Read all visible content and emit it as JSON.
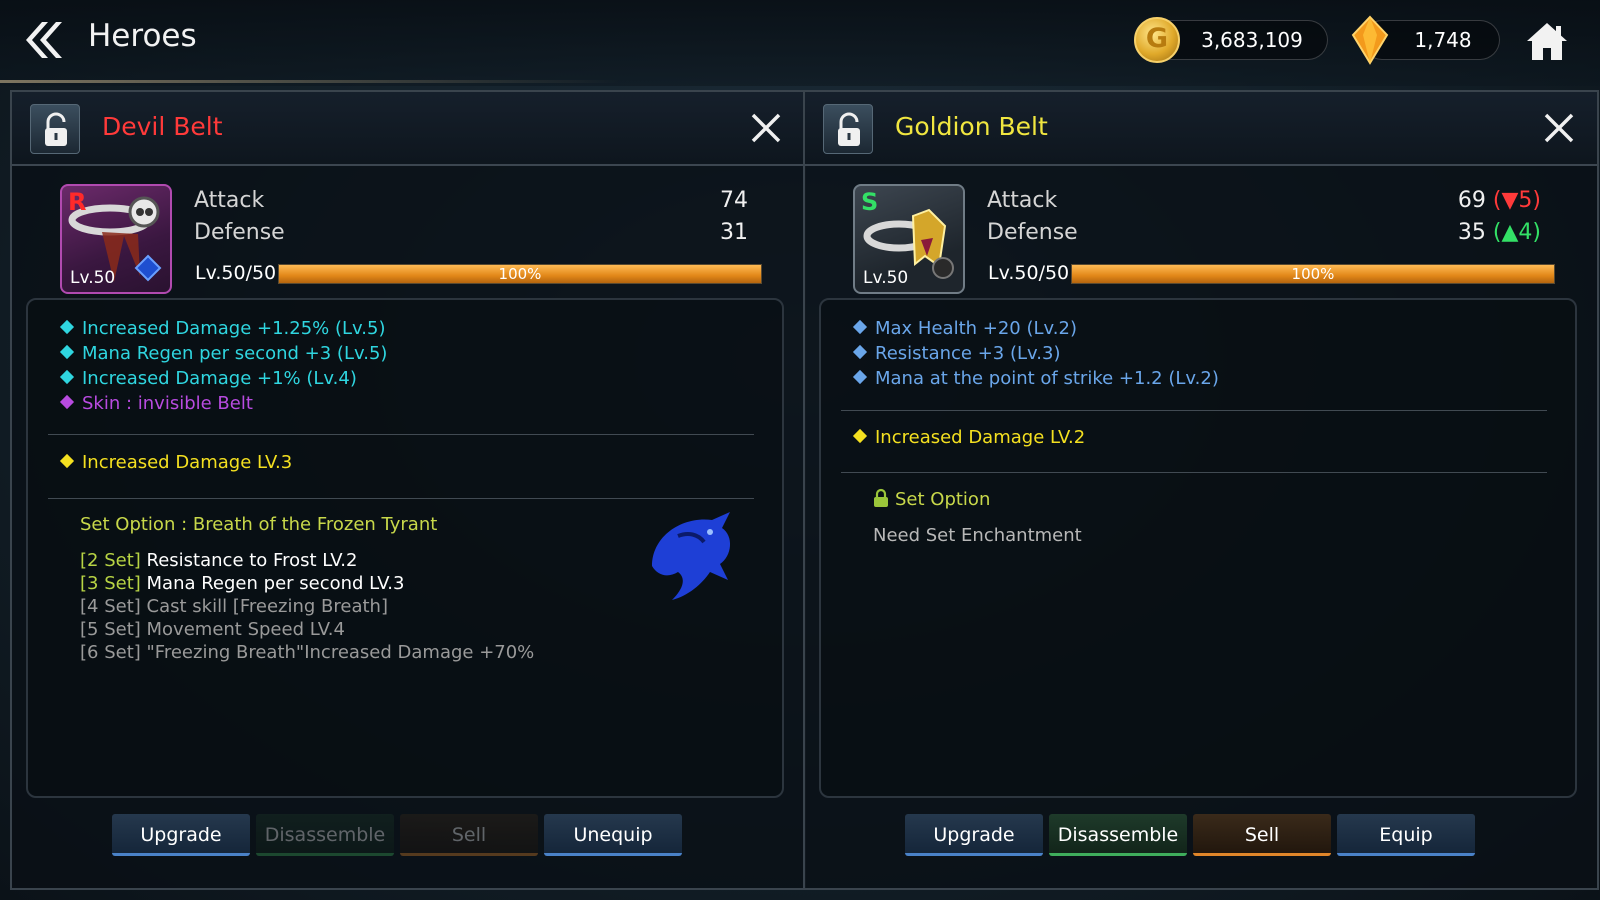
{
  "header": {
    "title": "Heroes",
    "gold": "3,683,109",
    "gold_icon_letter": "G",
    "gems": "1,748"
  },
  "left": {
    "name": "Devil Belt",
    "name_color": "#ff3a3a",
    "grade": "R",
    "icon_level": "Lv.50",
    "attack_label": "Attack",
    "attack_value": "74",
    "defense_label": "Defense",
    "defense_value": "31",
    "level_label": "Lv.50/50",
    "progress_text": "100%",
    "progress_fraction": 1.0,
    "options": [
      {
        "text": "Increased Damage +1.25% (Lv.5)",
        "color": "#2fd6e0"
      },
      {
        "text": "Mana Regen per second +3 (Lv.5)",
        "color": "#2fd6e0"
      },
      {
        "text": "Increased Damage +1% (Lv.4)",
        "color": "#2fd6e0"
      },
      {
        "text": "Skin : invisible Belt",
        "color": "#b84be0"
      }
    ],
    "special": "Increased Damage LV.3",
    "set_title": "Set Option : Breath of the Frozen Tyrant",
    "set_items": [
      {
        "tag": "[2 Set]",
        "text": "Resistance to Frost LV.2",
        "active": true
      },
      {
        "tag": "[3 Set]",
        "text": "Mana Regen per second LV.3",
        "active": true
      },
      {
        "tag": "[4 Set]",
        "text": "Cast skill [Freezing Breath]",
        "active": false
      },
      {
        "tag": "[5 Set]",
        "text": "Movement Speed LV.4",
        "active": false
      },
      {
        "tag": "[6 Set]",
        "text": "\"Freezing Breath\"Increased Damage +70%",
        "active": false
      }
    ],
    "buttons": {
      "upgrade": "Upgrade",
      "disassemble": "Disassemble",
      "sell": "Sell",
      "unequip": "Unequip"
    }
  },
  "right": {
    "name": "Goldion Belt",
    "name_color": "#f0e640",
    "grade": "S",
    "icon_level": "Lv.50",
    "attack_label": "Attack",
    "attack_value": "69",
    "attack_diff": "(▼5)",
    "defense_label": "Defense",
    "defense_value": "35",
    "defense_diff": "(▲4)",
    "level_label": "Lv.50/50",
    "progress_text": "100%",
    "progress_fraction": 1.0,
    "options": [
      {
        "text": "Max Health +20 (Lv.2)",
        "color": "#6aa6ea"
      },
      {
        "text": "Resistance +3 (Lv.3)",
        "color": "#6aa6ea"
      },
      {
        "text": "Mana at the point of strike +1.2 (Lv.2)",
        "color": "#6aa6ea"
      }
    ],
    "special": "Increased Damage LV.2",
    "set_title": "Set Option",
    "set_need": "Need Set Enchantment",
    "buttons": {
      "upgrade": "Upgrade",
      "disassemble": "Disassemble",
      "sell": "Sell",
      "equip": "Equip"
    }
  }
}
